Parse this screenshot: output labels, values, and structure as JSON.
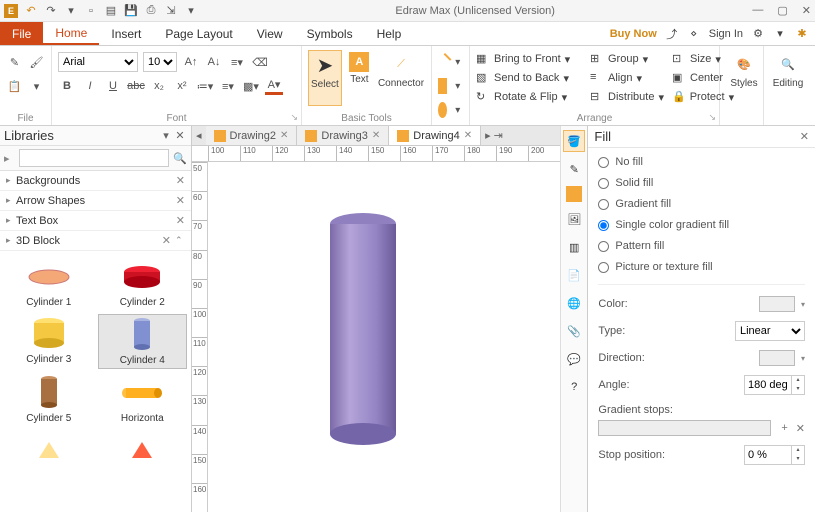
{
  "title": "Edraw Max (Unlicensed Version)",
  "menu": {
    "file": "File",
    "tabs": [
      "Home",
      "Insert",
      "Page Layout",
      "View",
      "Symbols",
      "Help"
    ],
    "active": "Home",
    "buy": "Buy Now",
    "signin": "Sign In"
  },
  "ribbon": {
    "groups": {
      "file": "File",
      "font": "Font",
      "basic": "Basic Tools",
      "arrange": "Arrange",
      "styles": "Styles",
      "editing": "Editing"
    },
    "font_name": "Arial",
    "font_size": "10",
    "select": "Select",
    "text": "Text",
    "connector": "Connector",
    "bring_front": "Bring to Front",
    "send_back": "Send to Back",
    "rotate_flip": "Rotate & Flip",
    "group": "Group",
    "align": "Align",
    "distribute": "Distribute",
    "size": "Size",
    "center": "Center",
    "protect": "Protect",
    "styles_label": "Styles",
    "editing_label": "Editing"
  },
  "libraries": {
    "title": "Libraries",
    "search_ph": "",
    "cats": [
      "Backgrounds",
      "Arrow Shapes",
      "Text Box",
      "3D Block"
    ],
    "shapes": [
      {
        "label": "Cylinder 1"
      },
      {
        "label": "Cylinder 2"
      },
      {
        "label": "Cylinder 3"
      },
      {
        "label": "Cylinder 4"
      },
      {
        "label": "Cylinder 5"
      },
      {
        "label": "Horizonta"
      }
    ]
  },
  "doc_tabs": [
    "Drawing2",
    "Drawing3",
    "Drawing4"
  ],
  "doc_active": "Drawing4",
  "ruler_h": [
    "100",
    "110",
    "120",
    "130",
    "140",
    "150",
    "160",
    "170",
    "180",
    "190",
    "200"
  ],
  "ruler_v": [
    "50",
    "60",
    "70",
    "80",
    "90",
    "100",
    "110",
    "120",
    "130",
    "140",
    "150",
    "160"
  ],
  "fill": {
    "title": "Fill",
    "opts": {
      "no_fill": "No fill",
      "solid": "Solid fill",
      "gradient": "Gradient fill",
      "single_grad": "Single color gradient fill",
      "pattern": "Pattern fill",
      "texture": "Picture or texture fill"
    },
    "color_lbl": "Color:",
    "type_lbl": "Type:",
    "type_val": "Linear",
    "direction_lbl": "Direction:",
    "angle_lbl": "Angle:",
    "angle_val": "180 deg",
    "gradstops_lbl": "Gradient stops:",
    "stoppos_lbl": "Stop position:",
    "stoppos_val": "0 %"
  }
}
